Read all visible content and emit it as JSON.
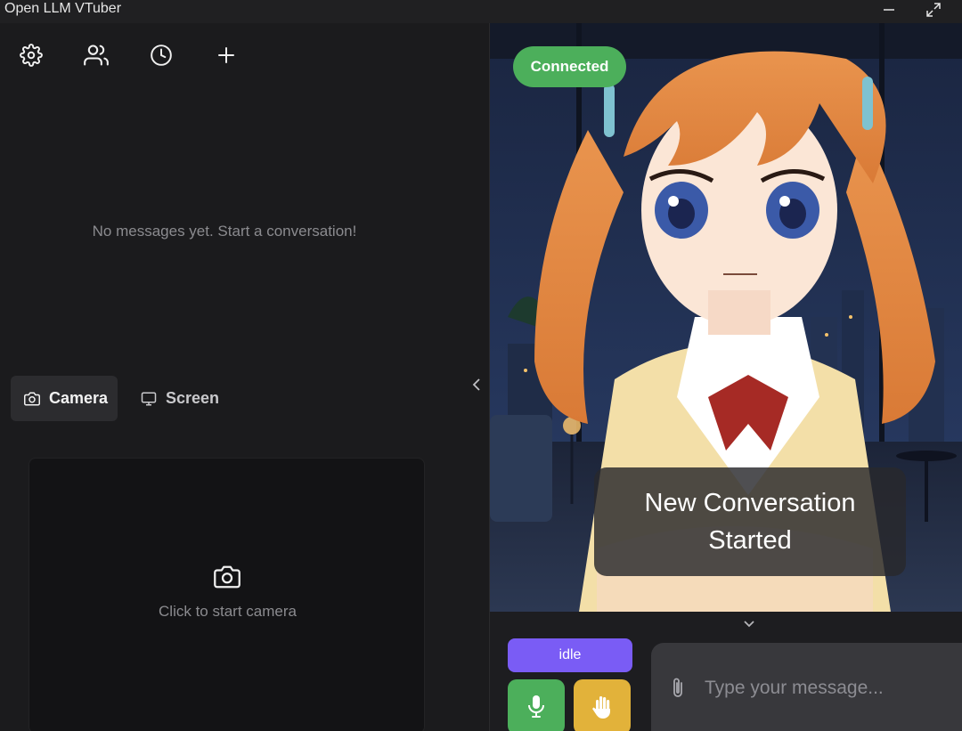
{
  "window": {
    "title": "Open LLM VTuber"
  },
  "toolbar": {
    "settings_icon": "gear-icon",
    "users_icon": "users-icon",
    "history_icon": "clock-icon",
    "new_icon": "plus-icon"
  },
  "chat": {
    "empty_message": "No messages yet. Start a conversation!"
  },
  "media_tabs": [
    {
      "label": "Camera",
      "icon": "camera-icon",
      "active": true
    },
    {
      "label": "Screen",
      "icon": "monitor-icon",
      "active": false
    }
  ],
  "camera": {
    "prompt": "Click to start camera"
  },
  "stage": {
    "status_badge": "Connected",
    "subtitle": "New Conversation Started"
  },
  "controls": {
    "state": "idle",
    "message_placeholder": "Type your message..."
  },
  "colors": {
    "connected": "#4caf5b",
    "state_pill": "#7a5cf5",
    "mic": "#4caf5b",
    "interrupt": "#e2b23a"
  }
}
